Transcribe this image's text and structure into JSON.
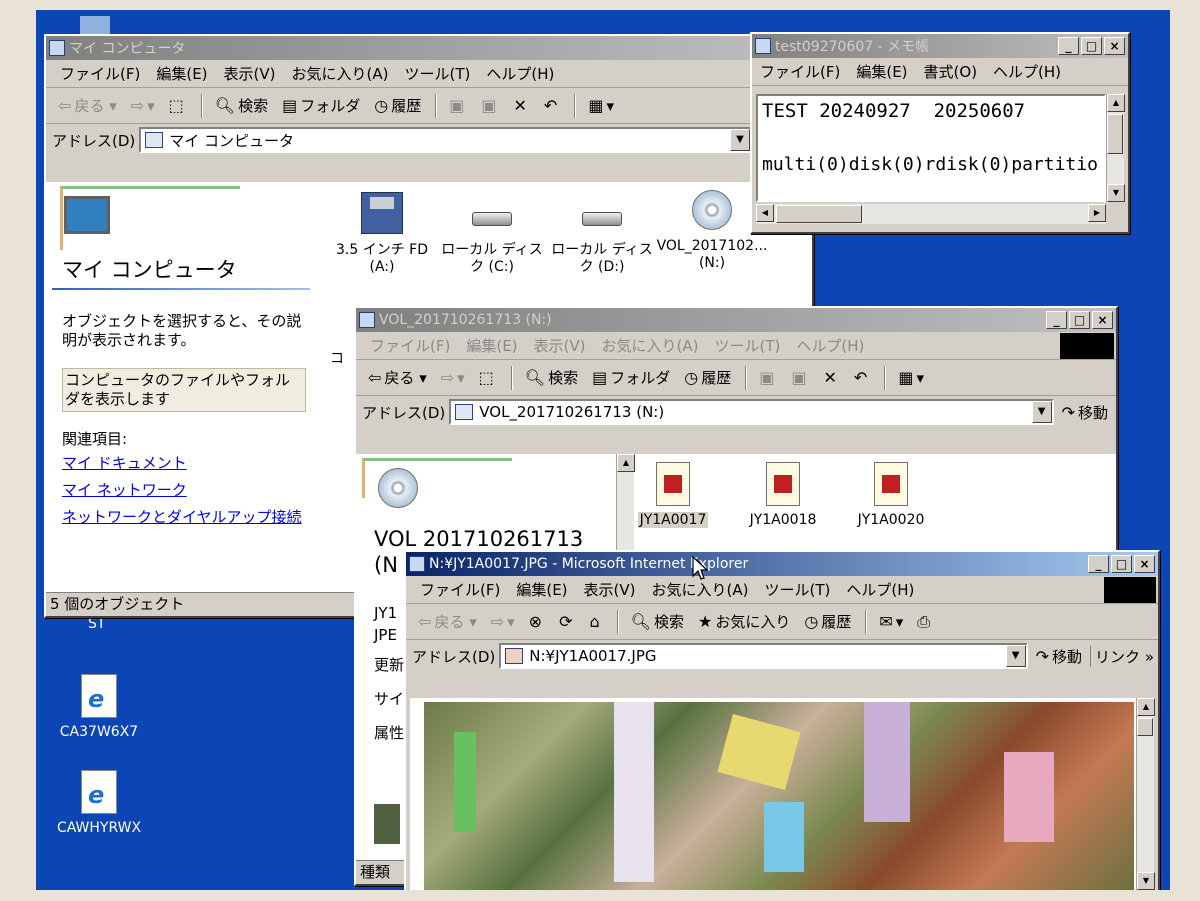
{
  "desktop": {
    "icons": [
      {
        "label": "CA37W6X7"
      },
      {
        "label": "CAWHYRWX"
      }
    ],
    "partial_label": "ST"
  },
  "mycomputer": {
    "title": "マイ コンピュータ",
    "menu": [
      "ファイル(F)",
      "編集(E)",
      "表示(V)",
      "お気に入り(A)",
      "ツール(T)",
      "ヘルプ(H)"
    ],
    "toolbar": {
      "back": "戻る",
      "search": "検索",
      "folders": "フォルダ",
      "history": "履歴"
    },
    "address_label": "アドレス(D)",
    "address_value": "マイ コンピュータ",
    "panel_title": "マイ コンピュータ",
    "panel_desc": "オブジェクトを選択すると、その説明が表示されます。",
    "panel_hint": "コンピュータのファイルやフォルダを表示します",
    "related_label": "関連項目:",
    "links": [
      "マイ ドキュメント",
      "マイ ネットワーク",
      "ネットワークとダイヤルアップ接続"
    ],
    "items": [
      {
        "line1": "3.5 インチ FD",
        "line2": "(A:)"
      },
      {
        "line1": "ローカル ディス",
        "line2": "ク (C:)"
      },
      {
        "line1": "ローカル ディス",
        "line2": "ク (D:)"
      },
      {
        "line1": "VOL_2017102...",
        "line2": "(N:)"
      }
    ],
    "partial_item": "コ",
    "status": "5 個のオブジェクト"
  },
  "notepad": {
    "title": "test09270607 - メモ帳",
    "menu": [
      "ファイル(F)",
      "編集(E)",
      "書式(O)",
      "ヘルプ(H)"
    ],
    "line1": "TEST 20240927  20250607",
    "line2": "multi(0)disk(0)rdisk(0)partitio"
  },
  "volume": {
    "title": "VOL_201710261713 (N:)",
    "menu": [
      "ファイル(F)",
      "編集(E)",
      "表示(V)",
      "お気に入り(A)",
      "ツール(T)",
      "ヘルプ(H)"
    ],
    "toolbar": {
      "back": "戻る",
      "search": "検索",
      "folders": "フォルダ",
      "history": "履歴"
    },
    "address_label": "アドレス(D)",
    "address_value": "VOL_201710261713 (N:)",
    "go": "移動",
    "panel_title_1": "VOL 201710261713",
    "panel_title_2": "(N",
    "panel_partial": [
      "JY1",
      "JPE",
      "更新",
      "サイ",
      "属性"
    ],
    "status": "種類",
    "files": [
      "JY1A0017",
      "JY1A0018",
      "JY1A0020"
    ]
  },
  "ie": {
    "title": "N:¥JY1A0017.JPG - Microsoft Internet Explorer",
    "menu": [
      "ファイル(F)",
      "編集(E)",
      "表示(V)",
      "お気に入り(A)",
      "ツール(T)",
      "ヘルプ(H)"
    ],
    "toolbar": {
      "back": "戻る",
      "search": "検索",
      "favorites": "お気に入り",
      "history": "履歴"
    },
    "address_label": "アドレス(D)",
    "address_value": "N:¥JY1A0017.JPG",
    "go": "移動",
    "links": "リンク"
  }
}
